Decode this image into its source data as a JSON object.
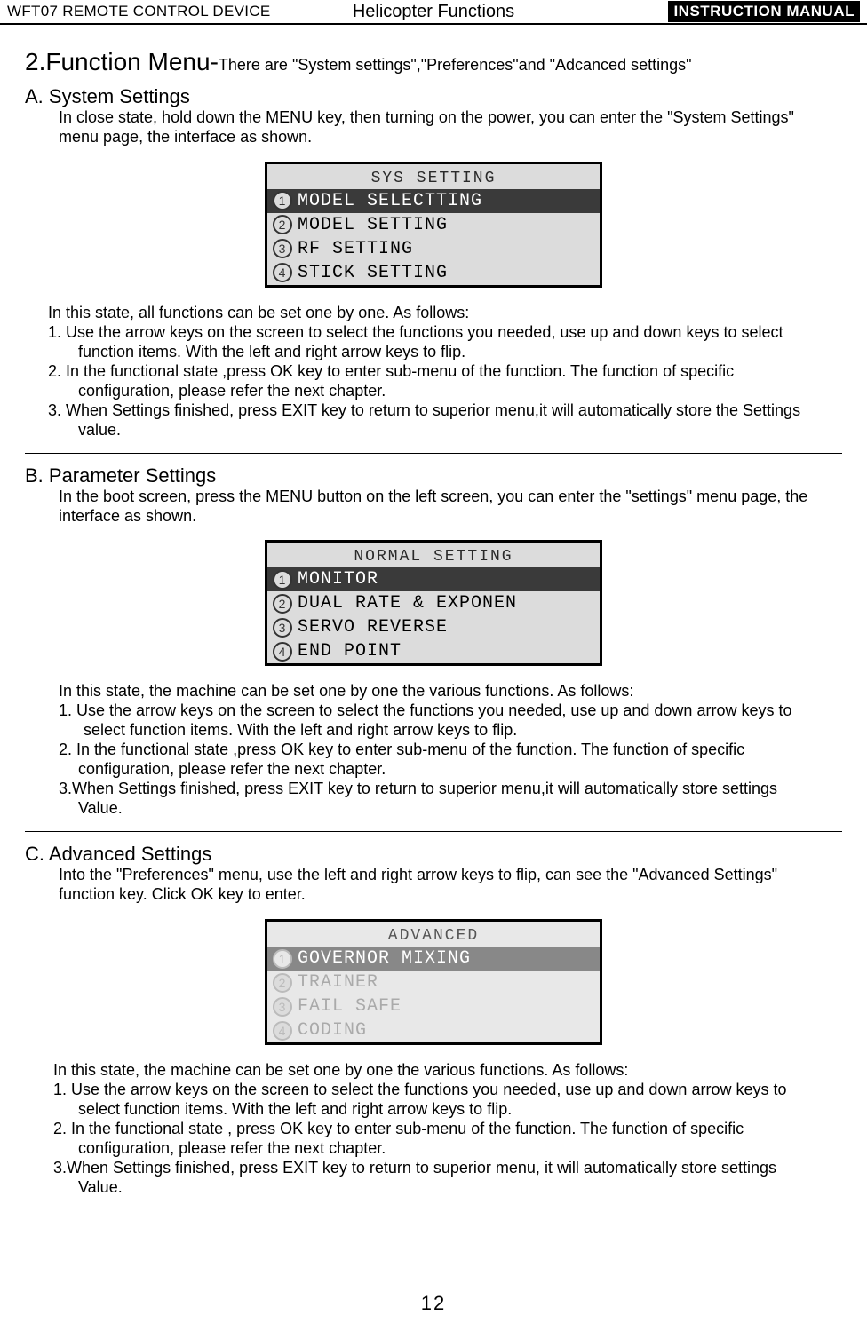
{
  "header": {
    "left": "WFT07 REMOTE CONTROL DEVICE",
    "center": "Helicopter Functions",
    "right": "INSTRUCTION MANUAL"
  },
  "main_title_prefix": "2.",
  "main_title": "Function Menu-",
  "main_subtitle": "There are \"System settings\",\"Preferences\"and \"Adcanced settings\"",
  "sectionA": {
    "title": "A. System Settings",
    "intro1": "In close state, hold down the MENU key, then turning on the power, you can enter the \"System   Settings\"",
    "intro2": " menu page, the interface as shown.",
    "screen_title": "SYS SETTING",
    "items": [
      {
        "n": "1",
        "label": "MODEL SELECTTING",
        "selected": true
      },
      {
        "n": "2",
        "label": "MODEL SETTING",
        "selected": false
      },
      {
        "n": "3",
        "label": "RF SETTING",
        "selected": false
      },
      {
        "n": "4",
        "label": "STICK SETTING",
        "selected": false
      }
    ],
    "follow0": "In this state, all functions can be set one by one. As follows:",
    "follow1a": "1. Use the arrow keys on the screen to select the functions you needed, use up and down keys to   select",
    "follow1b": "function items. With the left and right arrow keys to flip.",
    "follow2a": "2. In the functional state ,press OK key to enter sub-menu of the function. The function of specific",
    "follow2b": "configuration, please refer the next chapter.",
    "follow3a": "3. When Settings finished, press EXIT key to return to superior menu,it will automatically store the Settings",
    "follow3b": "value."
  },
  "sectionB": {
    "title": "B. Parameter Settings",
    "intro1": "In the boot screen, press the MENU button on the left screen, you can enter the \"settings\" menu page, the",
    "intro2": "interface as shown.",
    "screen_title": "NORMAL SETTING",
    "items": [
      {
        "n": "1",
        "label": "MONITOR",
        "selected": true
      },
      {
        "n": "2",
        "label": "DUAL RATE & EXPONEN",
        "selected": false
      },
      {
        "n": "3",
        "label": "SERVO REVERSE",
        "selected": false
      },
      {
        "n": "4",
        "label": "END POINT",
        "selected": false
      }
    ],
    "follow0": "In this state, the machine can be set one by one the various functions. As follows:",
    "follow1a": "1. Use the arrow keys on the screen to select the functions you needed, use up and down arrow keys to",
    "follow1b": " select function  items. With the left and right arrow keys to flip.",
    "follow2a": "2. In the functional state ,press OK key to enter sub-menu of the function. The function of specific",
    "follow2b": "configuration, please refer the next chapter.",
    "follow3a": "3.When Settings finished, press EXIT key to return to superior menu,it will automatically store settings",
    "follow3b": "Value."
  },
  "sectionC": {
    "title": "C. Advanced Settings",
    "intro1": "Into the \"Preferences\" menu, use the left and right arrow keys to flip, can see the \"Advanced Settings\"",
    "intro2": "function key. Click OK key to enter.",
    "screen_title": "ADVANCED",
    "items": [
      {
        "n": "1",
        "label": "GOVERNOR MIXING",
        "selected": true
      },
      {
        "n": "2",
        "label": "TRAINER",
        "selected": false
      },
      {
        "n": "3",
        "label": "FAIL SAFE",
        "selected": false
      },
      {
        "n": "4",
        "label": "CODING",
        "selected": false
      }
    ],
    "follow0": " In this state, the machine can be set one by one the various functions. As follows:",
    "follow1a": "1. Use the arrow keys on the screen to select the functions you needed, use up and down arrow keys to",
    "follow1b": "select function items. With the left and right arrow keys to flip.",
    "follow2a": "2. In the functional state , press OK key to enter sub-menu of the function. The function of specific",
    "follow2b": "configuration, please refer the next chapter.",
    "follow3a": "3.When Settings finished, press EXIT key to return to superior menu, it will automatically store settings",
    "follow3b": "Value."
  },
  "page_number": "12"
}
